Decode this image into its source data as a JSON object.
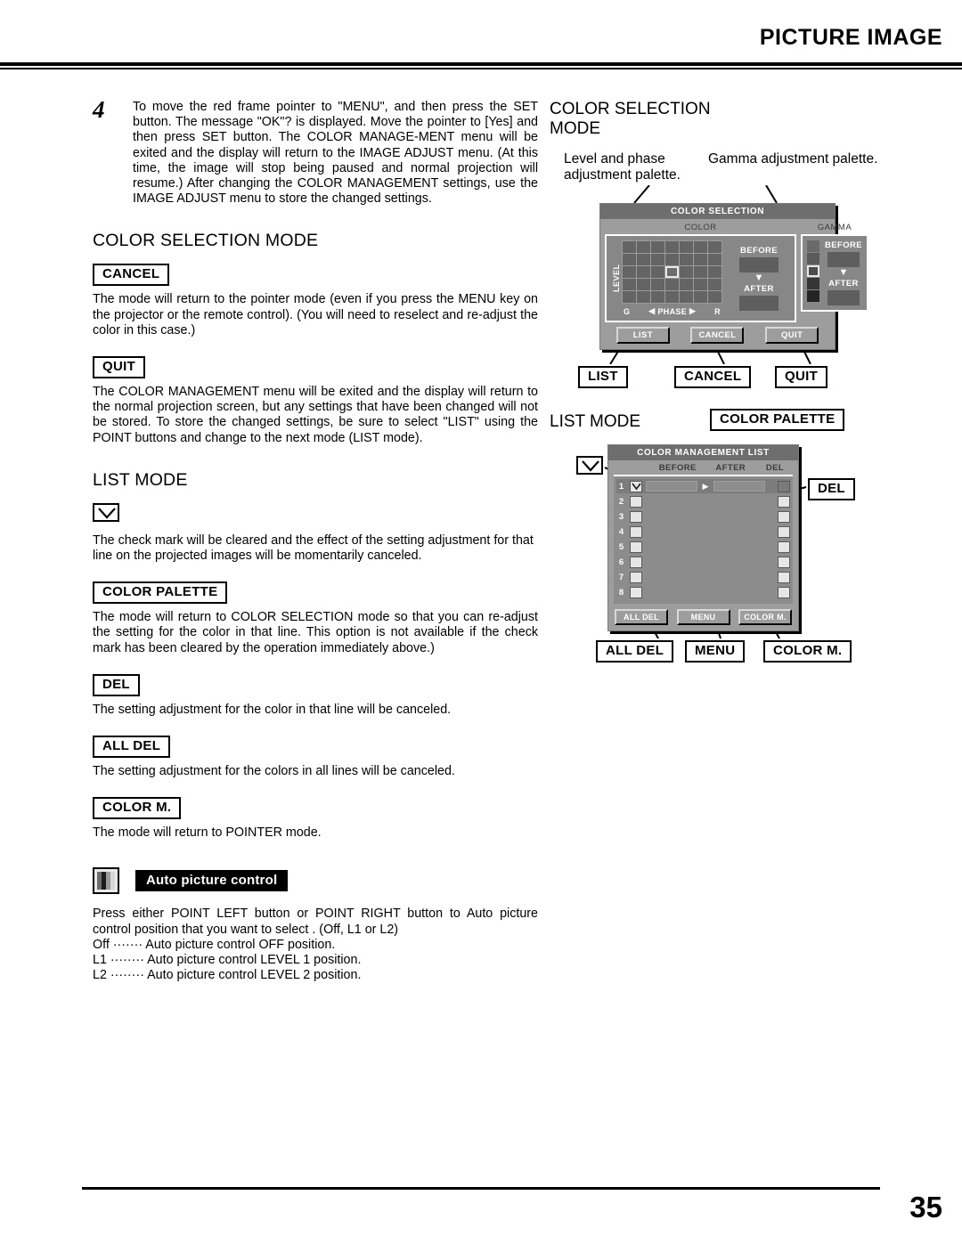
{
  "header": {
    "title": "PICTURE IMAGE"
  },
  "footer": {
    "page_number": "35"
  },
  "left_column": {
    "step": {
      "number": "4",
      "text": "To move the red frame pointer to \"MENU\", and then press the SET button. The message \"OK\"? is displayed. Move the pointer to [Yes] and then press SET button. The COLOR MANAGE-MENT menu will be exited and the display will return to the IMAGE ADJUST menu. (At this time, the image will stop being paused and normal projection will resume.) After changing the COLOR MANAGEMENT settings, use the IMAGE ADJUST menu to store the changed settings."
    },
    "color_selection_mode": {
      "heading": "COLOR SELECTION MODE",
      "entries": [
        {
          "key": "CANCEL",
          "body": "The mode will return to the pointer mode (even if you press the MENU key on the projector or the remote control). (You will need to reselect and re-adjust the color in this case.)"
        },
        {
          "key": "QUIT",
          "body": "The COLOR MANAGEMENT menu will be exited and the display will return to the normal projection screen, but any settings that have been changed will not be stored. To store the changed settings, be sure to select \"LIST\" using the POINT buttons and change to the next mode (LIST mode)."
        }
      ]
    },
    "list_mode": {
      "heading": "LIST MODE",
      "entries": [
        {
          "key": "check-mark-icon",
          "body": "The check mark will be cleared and the effect of the setting adjustment for that line on the projected images will be momentarily canceled."
        },
        {
          "key": "COLOR PALETTE",
          "body": "The mode will return to COLOR SELECTION mode so that you can re-adjust the setting for the color in that line. This option is not available if the check mark has been cleared by the operation immediately above.)"
        },
        {
          "key": "DEL",
          "body": "The setting adjustment for the color in that line will be canceled."
        },
        {
          "key": "ALL DEL",
          "body": "The setting adjustment for the colors in all lines will be canceled."
        },
        {
          "key": "COLOR M.",
          "body": "The mode will return to POINTER mode."
        }
      ]
    },
    "auto_picture_control": {
      "icon": "picture-bars-icon",
      "label": "Auto picture control",
      "body": "Press either POINT LEFT button or POINT RIGHT button to Auto picture control position that you want to select . (Off, L1 or L2)",
      "options": [
        "Off ······· Auto picture control OFF position.",
        "L1 ········ Auto picture control LEVEL 1 position.",
        "L2 ········ Auto picture control LEVEL 2 position."
      ]
    }
  },
  "right_column": {
    "color_selection": {
      "heading_line1": "COLOR SELECTION",
      "heading_line2": "MODE",
      "callout_left": "Level and phase adjustment palette.",
      "callout_right": "Gamma adjustment palette.",
      "dialog": {
        "title": "COLOR SELECTION",
        "color_panel_caption": "COLOR",
        "gamma_panel_caption": "GAMMA",
        "level_label": "LEVEL",
        "phase_label": "PHASE",
        "phase_left_marker": "G",
        "phase_right_marker": "R",
        "before_label": "BEFORE",
        "after_label": "AFTER",
        "gamma_before_label": "BEFORE",
        "gamma_after_label": "AFTER",
        "buttons": [
          "LIST",
          "CANCEL",
          "QUIT"
        ],
        "grid_columns": 7,
        "grid_rows": 5,
        "grid_selected_index": 17,
        "gamma_swatches": [
          "#6a6a6a",
          "#5a5a5a",
          "#4c4c4c",
          "#353535",
          "#242424"
        ],
        "gamma_selected_index": 2
      },
      "labels": [
        "LIST",
        "CANCEL",
        "QUIT"
      ]
    },
    "list_mode": {
      "heading": "LIST MODE",
      "label_color_palette": "COLOR PALETTE",
      "label_del": "DEL",
      "dialog": {
        "title": "COLOR MANAGEMENT LIST",
        "columns": [
          "BEFORE",
          "AFTER",
          "DEL"
        ],
        "rows": [
          {
            "number": "1",
            "checked": true
          },
          {
            "number": "2",
            "checked": false
          },
          {
            "number": "3",
            "checked": false
          },
          {
            "number": "4",
            "checked": false
          },
          {
            "number": "5",
            "checked": false
          },
          {
            "number": "6",
            "checked": false
          },
          {
            "number": "7",
            "checked": false
          },
          {
            "number": "8",
            "checked": false
          }
        ],
        "buttons": [
          "ALL DEL",
          "MENU",
          "COLOR M."
        ]
      },
      "labels": [
        "ALL DEL",
        "MENU",
        "COLOR M."
      ]
    }
  }
}
